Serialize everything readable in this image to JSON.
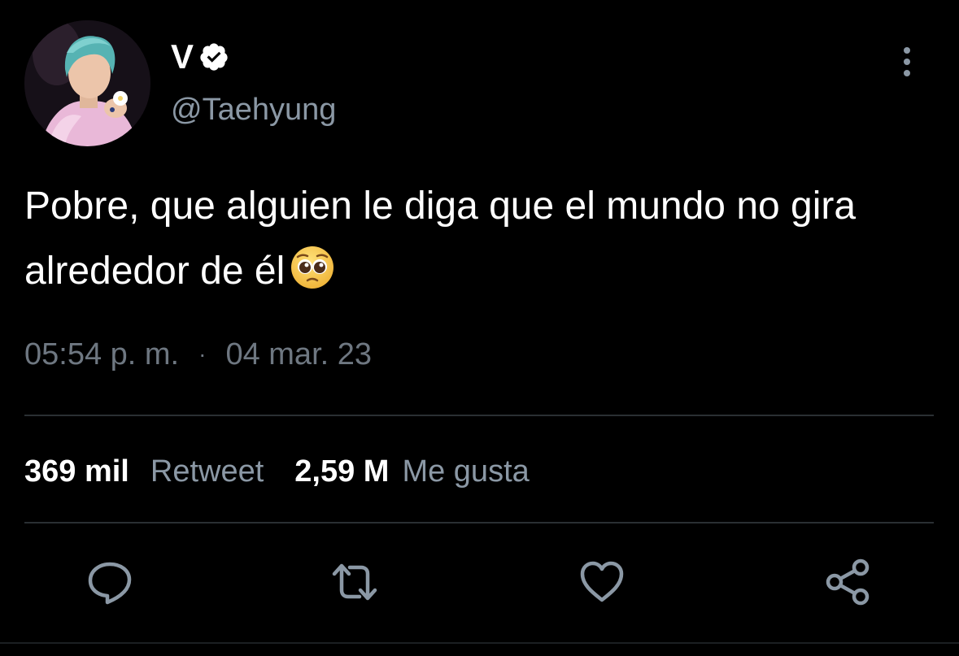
{
  "author": {
    "display_name": "V",
    "handle": "@Taehyung",
    "verified": true,
    "avatar_icon": "profile-photo"
  },
  "tweet": {
    "text": "Pobre, que alguien le diga que el mundo no gira alrededor de él",
    "emoji": "pleading-face-emoji",
    "time": "05:54 p. m.",
    "separator": "·",
    "date": "04 mar. 23"
  },
  "stats": {
    "retweets_count": "369 mil",
    "retweets_label": "Retweet",
    "likes_count": "2,59 M",
    "likes_label": "Me gusta"
  },
  "actions": [
    {
      "name": "reply",
      "icon": "speech-bubble-icon"
    },
    {
      "name": "retweet",
      "icon": "retweet-icon"
    },
    {
      "name": "like",
      "icon": "heart-icon"
    },
    {
      "name": "share",
      "icon": "share-icon"
    }
  ],
  "colors": {
    "background": "#000000",
    "primary_text": "#ffffff",
    "secondary_text": "#8b98a5",
    "meta_text": "#6e7781",
    "divider": "#2a2f33"
  }
}
